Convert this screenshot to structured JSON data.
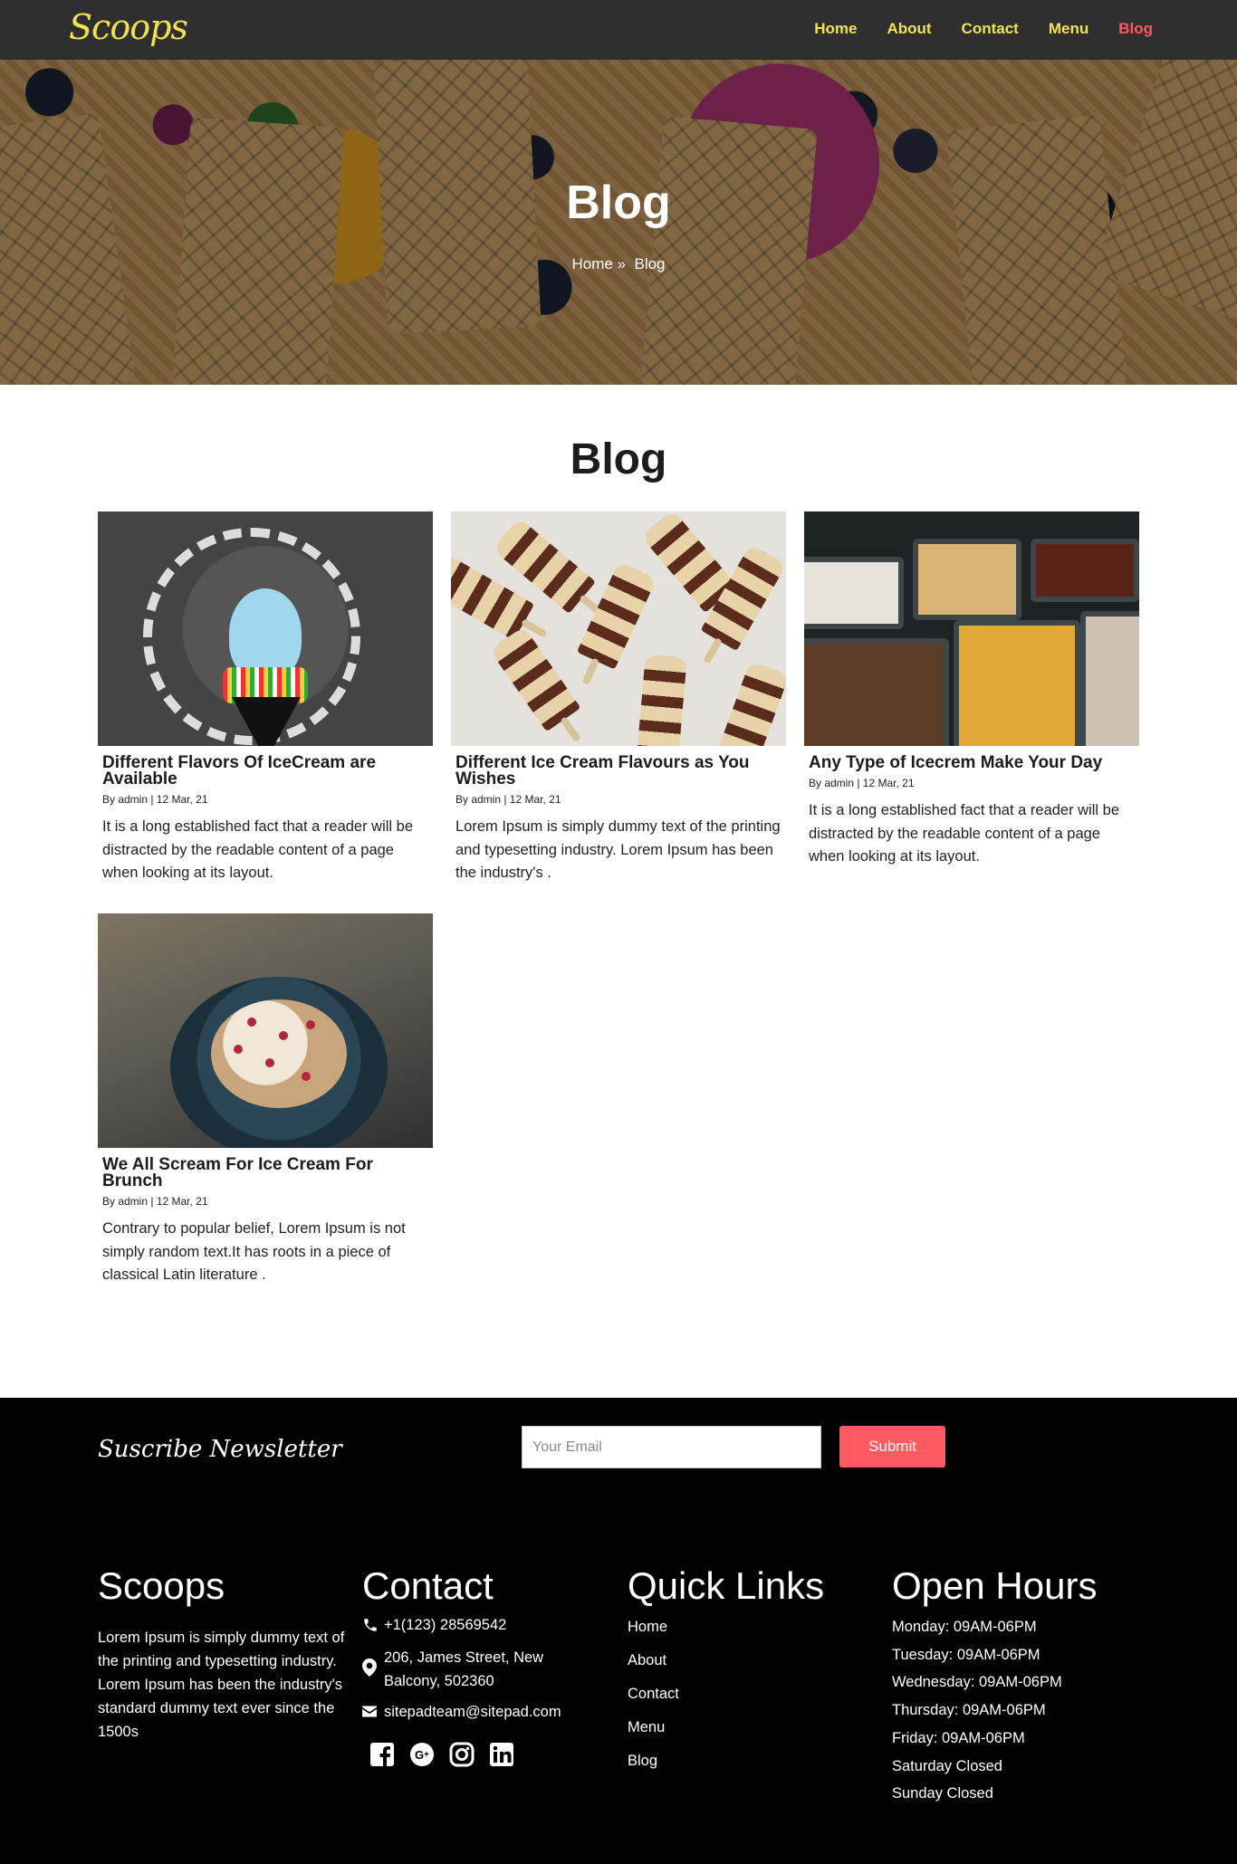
{
  "brand": {
    "logo": "Scoops"
  },
  "nav": {
    "items": [
      {
        "label": "Home"
      },
      {
        "label": "About"
      },
      {
        "label": "Contact"
      },
      {
        "label": "Menu"
      },
      {
        "label": "Blog",
        "active": true
      }
    ]
  },
  "hero": {
    "title": "Blog",
    "breadcrumb": {
      "home": "Home",
      "separator": "»",
      "current": "Blog"
    }
  },
  "blog": {
    "section_title": "Blog",
    "posts": [
      {
        "title": "Different Flavors Of IceCream are Available",
        "meta": "By admin | 12 Mar, 21",
        "excerpt": "It is a long established fact that a reader will be distracted by the readable content of a page when looking at its layout."
      },
      {
        "title": "Different Ice Cream Flavours as You Wishes",
        "meta": "By admin | 12 Mar, 21",
        "excerpt": "Lorem Ipsum is simply dummy text of the printing and typesetting industry. Lorem Ipsum has been the industry's ."
      },
      {
        "title": "Any Type of Icecrem Make Your Day",
        "meta": "By admin | 12 Mar, 21",
        "excerpt": "It is a long established fact that a reader will be distracted by the readable content of a page when looking at its layout."
      },
      {
        "title": "We All Scream For Ice Cream For Brunch",
        "meta": "By admin | 12 Mar, 21",
        "excerpt": "Contrary to popular belief, Lorem Ipsum is not simply random text.It has roots in a piece of classical Latin literature ."
      }
    ]
  },
  "newsletter": {
    "label": "Suscribe Newsletter",
    "email_placeholder": "Your Email",
    "submit_label": "Submit"
  },
  "footer": {
    "about": {
      "heading": "Scoops",
      "text": "Lorem Ipsum is simply dummy text of the printing and typesetting industry. Lorem Ipsum has been the industry's standard dummy text ever since the 1500s"
    },
    "contact": {
      "heading": "Contact",
      "phone": "+1(123) 28569542",
      "address": "206, James Street, New Balcony, 502360",
      "email": "sitepadteam@sitepad.com",
      "social": [
        "facebook-icon",
        "google-plus-icon",
        "instagram-icon",
        "linkedin-icon"
      ]
    },
    "quick_links": {
      "heading": "Quick Links",
      "items": [
        "Home",
        "About",
        "Contact",
        "Menu",
        "Blog"
      ]
    },
    "hours": {
      "heading": "Open Hours",
      "rows": [
        "Monday: 09AM-06PM",
        "Tuesday: 09AM-06PM",
        "Wednesday: 09AM-06PM",
        "Thursday: 09AM-06PM",
        "Friday: 09AM-06PM",
        "Saturday Closed",
        "Sunday Closed"
      ]
    }
  },
  "colors": {
    "nav_bg": "#2f2f2f",
    "nav_link": "#f3e24f",
    "accent": "#ff5a5f",
    "footer_bg": "#000000"
  }
}
